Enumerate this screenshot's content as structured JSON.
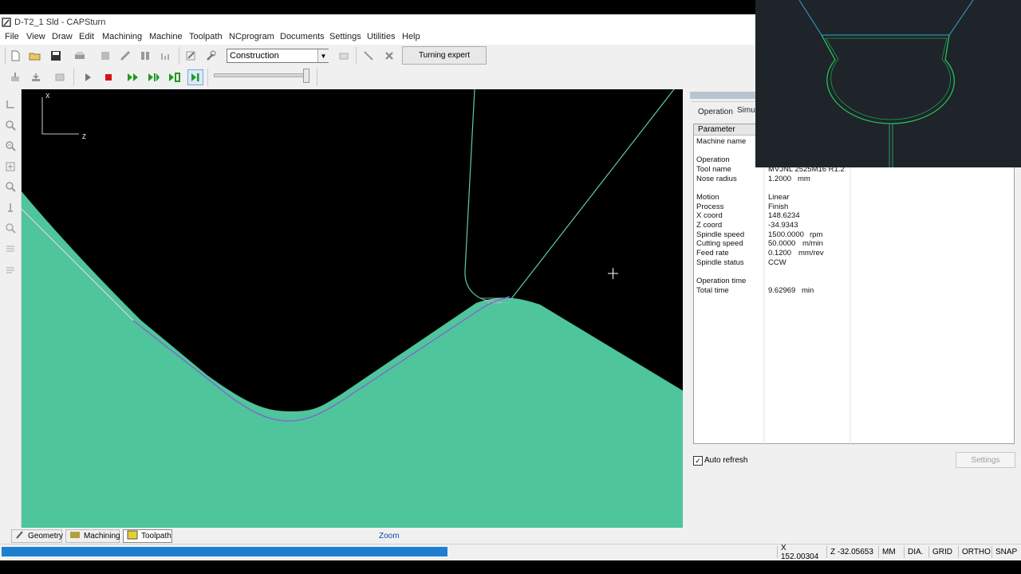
{
  "window": {
    "title": "D-T2_1 Sld - CAPSturn"
  },
  "menu": [
    "File",
    "View",
    "Draw",
    "Edit",
    "Machining",
    "Machine",
    "Toolpath",
    "NCprogram",
    "Documents",
    "Settings",
    "Utilities",
    "Help"
  ],
  "toolbar": {
    "mode_value": "Construction",
    "turning_expert_label": "Turning expert"
  },
  "canvas": {
    "axis_x_label": "X",
    "axis_z_label": "Z",
    "colors": {
      "stock": "#4ec59b",
      "tool_outline": "#5fc9b5",
      "toolpath": "#8a5cd6",
      "background": "#000000"
    }
  },
  "panel": {
    "tab_operation": "Operation",
    "tab_simulation": "Simula",
    "param_header": "Parameter",
    "rows": [
      {
        "label": "Machine name",
        "value": "",
        "unit": ""
      },
      {
        "label": "Operation",
        "value": "",
        "unit": ""
      },
      {
        "label": "Tool name",
        "value": "MVJNL 2525M16 R1.2",
        "unit": ""
      },
      {
        "label": "Nose radius",
        "value": "1.2000",
        "unit": "mm"
      },
      {
        "label": "Motion",
        "value": "Linear",
        "unit": ""
      },
      {
        "label": "Process",
        "value": "Finish",
        "unit": ""
      },
      {
        "label": "X coord",
        "value": "148.6234",
        "unit": ""
      },
      {
        "label": "Z coord",
        "value": "-34.9343",
        "unit": ""
      },
      {
        "label": "Spindle speed",
        "value": "1500.0000",
        "unit": "rpm"
      },
      {
        "label": "Cutting speed",
        "value": "50.0000",
        "unit": "m/min"
      },
      {
        "label": "Feed rate",
        "value": "0.1200",
        "unit": "mm/rev"
      },
      {
        "label": "Spindle status",
        "value": "CCW",
        "unit": ""
      },
      {
        "label": "Operation time",
        "value": "",
        "unit": ""
      },
      {
        "label": "Total time",
        "value": "9.62969",
        "unit": "min"
      }
    ],
    "auto_refresh_label": "Auto refresh",
    "auto_refresh_checked": true,
    "settings_label": "Settings"
  },
  "bottom_tabs": [
    "Geometry",
    "Machining",
    "Toolpath"
  ],
  "zoom_label": "Zoom",
  "status": {
    "progress_fraction": 0.44,
    "x_readout": "X  152.00304",
    "z_readout": "Z  -32.05653",
    "units": "MM",
    "dia": "DIA.",
    "grid": "GRID",
    "ortho": "ORTHO",
    "snap": "SNAP"
  }
}
